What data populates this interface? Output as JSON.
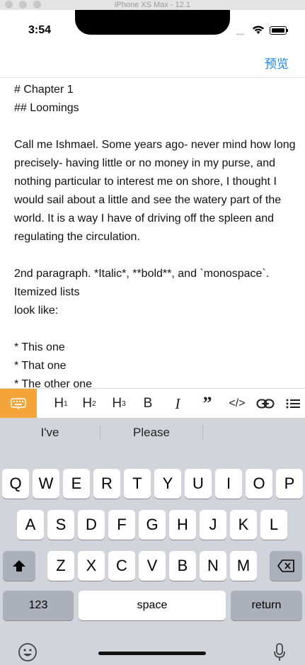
{
  "simulator": {
    "title": "iPhone XS Max - 12.1"
  },
  "status_bar": {
    "time": "3:54",
    "signal": "••••"
  },
  "nav": {
    "preview_label": "预览"
  },
  "editor": {
    "text": "# Chapter 1\n## Loomings\n\nCall me Ishmael. Some years ago- never mind how long precisely- having little or no money in my purse, and nothing particular to interest me on shore, I thought I would sail about a little and see the watery part of the world. It is a way I have of driving off the spleen and regulating the circulation.\n\n2nd paragraph. *Italic*, **bold**, and `monospace`. Itemized lists\nlook like:\n\n* This one\n* That one\n* The other one"
  },
  "toolbar": {
    "h1": "H",
    "h1_sub": "1",
    "h2": "H",
    "h2_sub": "2",
    "h3": "H",
    "h3_sub": "3",
    "bold": "B",
    "italic": "I",
    "quote": "”",
    "code": "</>",
    "accent_color": "#f3a53a"
  },
  "keyboard": {
    "suggestions": [
      "I've",
      "Please",
      ""
    ],
    "row1": [
      "Q",
      "W",
      "E",
      "R",
      "T",
      "Y",
      "U",
      "I",
      "O",
      "P"
    ],
    "row2": [
      "A",
      "S",
      "D",
      "F",
      "G",
      "H",
      "J",
      "K",
      "L"
    ],
    "row3": [
      "Z",
      "X",
      "C",
      "V",
      "B",
      "N",
      "M"
    ],
    "numbers_label": "123",
    "space_label": "space",
    "return_label": "return"
  }
}
